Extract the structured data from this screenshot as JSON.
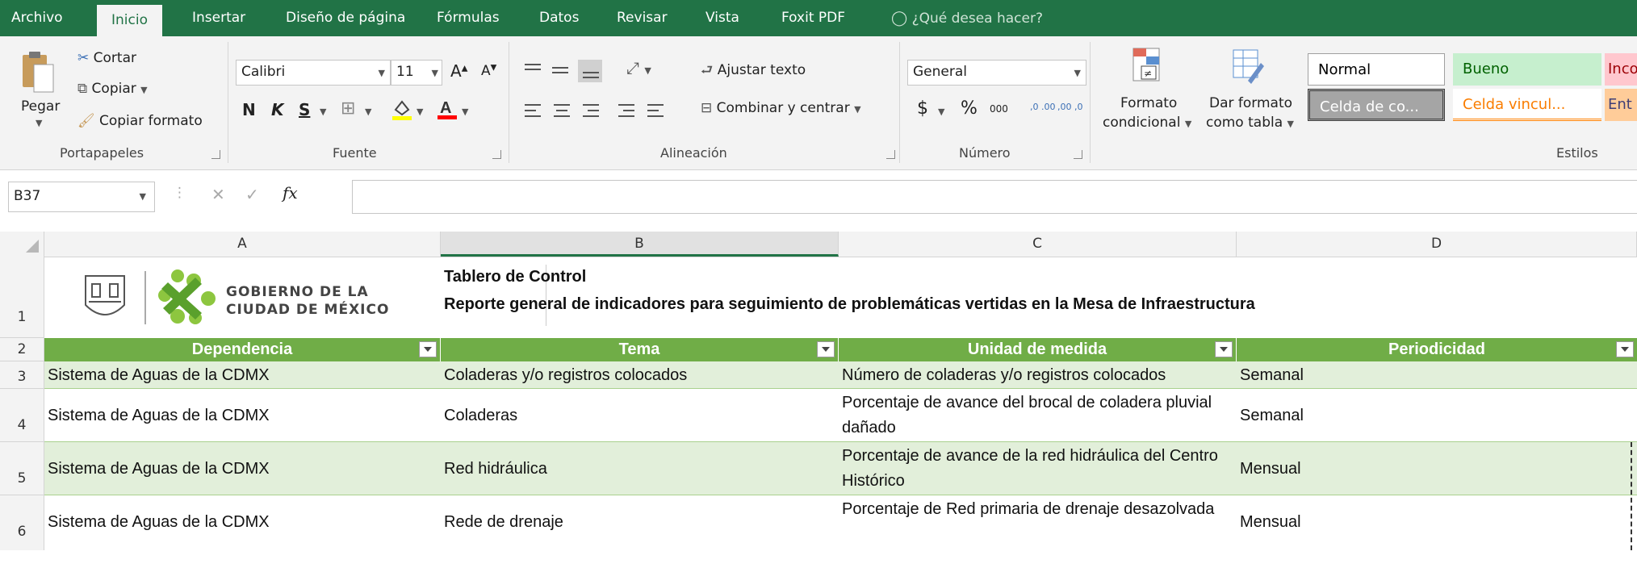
{
  "tabs": [
    "Archivo",
    "Inicio",
    "Insertar",
    "Diseño de página",
    "Fórmulas",
    "Datos",
    "Revisar",
    "Vista",
    "Foxit PDF"
  ],
  "tell_me": "¿Qué desea hacer?",
  "clipboard": {
    "paste": "Pegar",
    "cut": "Cortar",
    "copy": "Copiar",
    "format_painter": "Copiar formato",
    "group": "Portapapeles"
  },
  "font": {
    "name": "Calibri",
    "size": "11",
    "bold": "N",
    "italic": "K",
    "underline": "S",
    "group": "Fuente"
  },
  "alignment": {
    "wrap": "Ajustar texto",
    "merge": "Combinar y centrar",
    "group": "Alineación"
  },
  "number": {
    "format": "General",
    "currency": "$",
    "percent": "%",
    "thousands": "000",
    "inc_dec": ",0 .00",
    "dec_dec": ",00 ,0",
    "group": "Número"
  },
  "styles": {
    "conditional_1": "Formato",
    "conditional_2": "condicional",
    "table_1": "Dar formato",
    "table_2": "como tabla",
    "normal": "Normal",
    "good": "Bueno",
    "bad": "Inco",
    "check": "Celda de co...",
    "linked": "Celda vincul...",
    "input": "Ent",
    "group": "Estilos",
    "colors": {
      "good_bg": "#c6efce",
      "good_fg": "#006100",
      "bad_bg": "#ffc7ce",
      "bad_fg": "#9c0006",
      "linked_fg": "#fa7d00",
      "input_bg": "#ffcc99",
      "check_bg": "#a5a5a5"
    }
  },
  "formula_bar": {
    "name_box": "B37",
    "cancel": "✕",
    "enter": "✓",
    "fx": "fx",
    "value": ""
  },
  "columns": [
    "A",
    "B",
    "C",
    "D"
  ],
  "logo": {
    "line1": "GOBIERNO DE LA",
    "line2": "CIUDAD DE MÉXICO"
  },
  "title": {
    "line1": "Tablero de Control",
    "line2": "Reporte general de indicadores para seguimiento de problemáticas vertidas en la Mesa de Infraestructura"
  },
  "table": {
    "headers": [
      "Dependencia",
      "Tema",
      "Unidad de medida",
      "Periodicidad"
    ],
    "rows": [
      {
        "num": "3",
        "cells": [
          "Sistema de Aguas de la CDMX",
          "Coladeras y/o registros colocados",
          "Número de coladeras y/o registros colocados",
          "Semanal"
        ]
      },
      {
        "num": "4",
        "cells": [
          "Sistema de Aguas de la CDMX",
          "Coladeras",
          "Porcentaje de avance del brocal de coladera pluvial dañado",
          "Semanal"
        ]
      },
      {
        "num": "5",
        "cells": [
          "Sistema de Aguas de la CDMX",
          "Red hidráulica",
          "Porcentaje de avance de la red hidráulica del Centro Histórico",
          "Mensual"
        ]
      },
      {
        "num": "6",
        "cells": [
          "Sistema de Aguas de la CDMX",
          "Rede de drenaje",
          "Porcentaje de Red primaria de drenaje desazolvada",
          "Mensual"
        ]
      }
    ]
  },
  "row_numbers": [
    "1",
    "2"
  ],
  "colors": {
    "accent": "#217346",
    "table_header": "#70ad47",
    "band": "#e2efda"
  }
}
